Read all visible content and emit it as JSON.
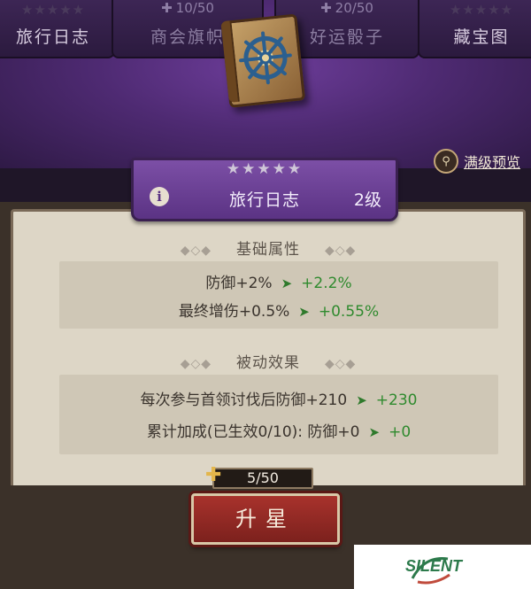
{
  "tabs": [
    {
      "label": "旅行日志",
      "stars": "★★★★★",
      "progress": ""
    },
    {
      "label": "商会旗帜",
      "stars": "",
      "progress": "10/50"
    },
    {
      "label": "好运骰子",
      "stars": "",
      "progress": "20/50"
    },
    {
      "label": "藏宝图",
      "stars": "★★★★★",
      "progress": ""
    }
  ],
  "preview": {
    "label": "满级预览",
    "icon": "magnifier-icon"
  },
  "artifact": {
    "stars": "★★★★★",
    "name": "旅行日志",
    "level": "2级",
    "info_icon": "i"
  },
  "base_attrs": {
    "title": "基础属性",
    "rows": [
      {
        "text": "防御+2%",
        "next": "+2.2%"
      },
      {
        "text": "最终增伤+0.5%",
        "next": "+0.55%"
      }
    ]
  },
  "passive": {
    "title": "被动效果",
    "rows": [
      {
        "text": "每次参与首领讨伐后防御+210",
        "next": "+230"
      },
      {
        "text": "累计加成(已生效0/10): 防御+0",
        "next": "+0"
      }
    ]
  },
  "shards": {
    "value": "5/50",
    "icon": "puzzle-icon"
  },
  "upgrade": {
    "label": "升星"
  },
  "watermark": {
    "text": "SILENT"
  },
  "colors": {
    "accent_purple": "#6d3d9a",
    "upgrade_red": "#a8322c",
    "value_green": "#2f8a2e"
  }
}
